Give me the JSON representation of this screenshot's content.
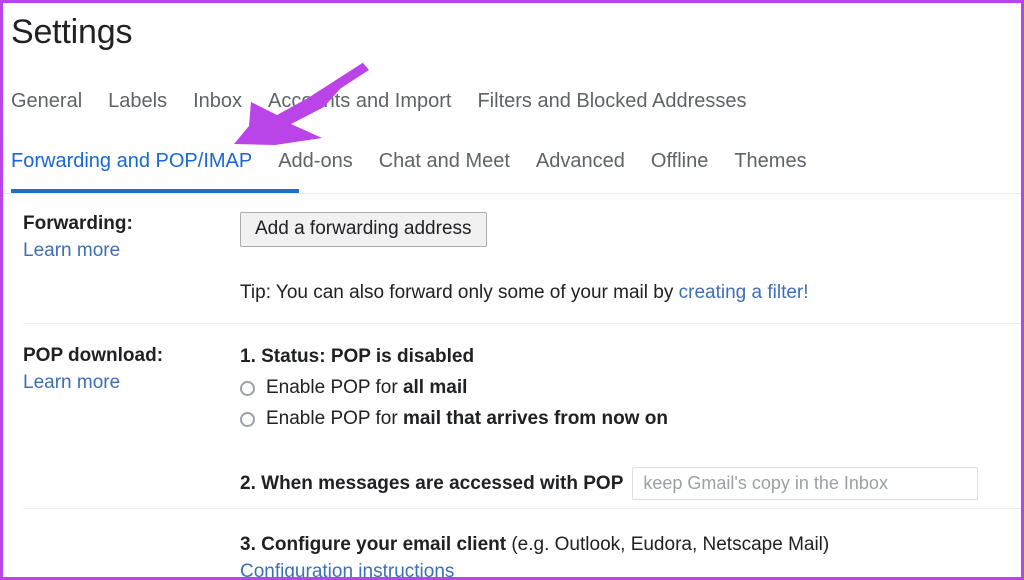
{
  "window": {
    "title": "Settings",
    "annotation_color": "#bb44e8",
    "accent_color": "#1a73c8",
    "link_color": "#3c6fb4"
  },
  "tabs_row_1": [
    {
      "label": "General",
      "active": false
    },
    {
      "label": "Labels",
      "active": false
    },
    {
      "label": "Inbox",
      "active": false
    },
    {
      "label": "Accounts and Import",
      "active": false
    },
    {
      "label": "Filters and Blocked Addresses",
      "active": false
    }
  ],
  "tabs_row_2": [
    {
      "label": "Forwarding and POP/IMAP",
      "active": true
    },
    {
      "label": "Add-ons",
      "active": false
    },
    {
      "label": "Chat and Meet",
      "active": false
    },
    {
      "label": "Advanced",
      "active": false
    },
    {
      "label": "Offline",
      "active": false
    },
    {
      "label": "Themes",
      "active": false
    }
  ],
  "forwarding": {
    "label": "Forwarding:",
    "learn_more": "Learn more",
    "add_button": "Add a forwarding address",
    "tip_prefix": "Tip: You can also forward only some of your mail by ",
    "tip_link": "creating a filter!"
  },
  "pop_download": {
    "label": "POP download:",
    "learn_more": "Learn more",
    "step1_prefix": "1. Status:",
    "step1_value": "POP is disabled",
    "options": [
      {
        "prefix": "Enable POP for ",
        "bold": "all mail",
        "selected": false
      },
      {
        "prefix": "Enable POP for ",
        "bold": "mail that arrives from now on",
        "selected": false
      }
    ],
    "step2_number": "2.",
    "step2_text": "When messages are accessed with POP",
    "step2_select_value": "keep Gmail's copy in the Inbox",
    "step3_number": "3.",
    "step3_bold": "Configure your email client",
    "step3_rest": " (e.g. Outlook, Eudora, Netscape Mail)",
    "step3_link": "Configuration instructions"
  },
  "annotation": {
    "arrow_name": "purple-arrow-pointing-to-forwarding-tab",
    "color": "#bb44e8"
  }
}
